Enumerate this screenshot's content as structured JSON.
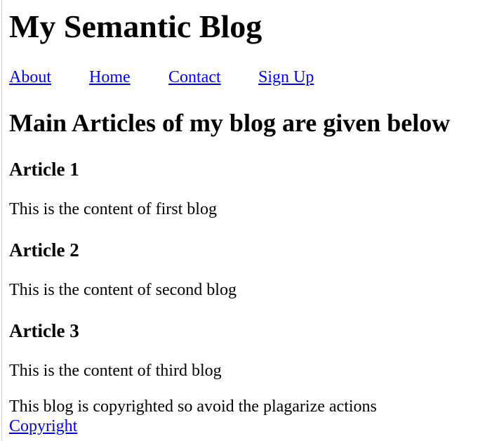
{
  "header": {
    "title": "My Semantic Blog"
  },
  "nav": {
    "items": [
      {
        "label": "About"
      },
      {
        "label": "Home"
      },
      {
        "label": "Contact"
      },
      {
        "label": "Sign Up"
      }
    ]
  },
  "main": {
    "heading": "Main Articles of my blog are given below",
    "articles": [
      {
        "title": "Article 1",
        "body": "This is the content of first blog"
      },
      {
        "title": "Article 2",
        "body": "This is the content of second blog"
      },
      {
        "title": "Article 3",
        "body": "This is the content of third blog"
      }
    ]
  },
  "footer": {
    "text": "This blog is copyrighted so avoid the plagarize actions",
    "link_label": "Copyright"
  },
  "colors": {
    "link": "#0000ee",
    "text": "#000000",
    "background": "#ffffff"
  }
}
